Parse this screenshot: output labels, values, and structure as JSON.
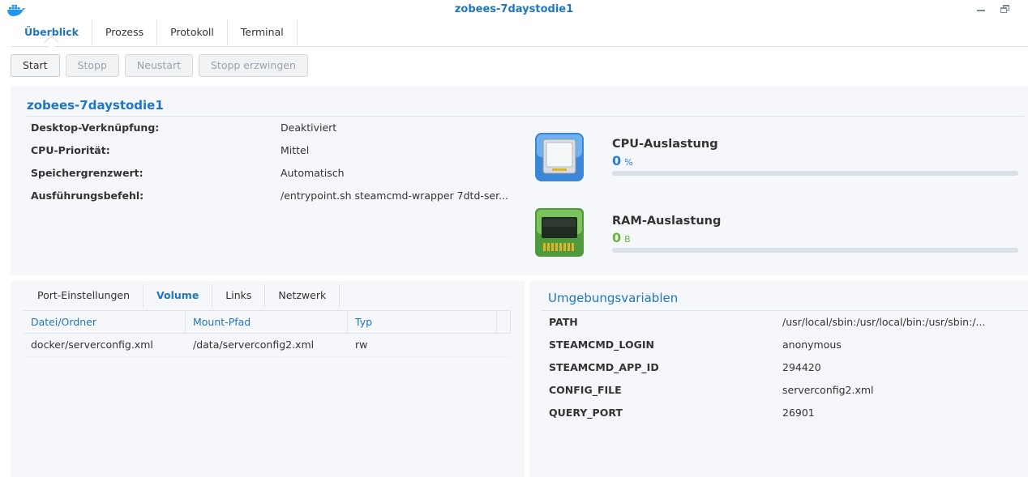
{
  "window": {
    "title": "zobees-7daystodie1"
  },
  "tabs": [
    {
      "label": "Überblick",
      "active": true
    },
    {
      "label": "Prozess"
    },
    {
      "label": "Protokoll"
    },
    {
      "label": "Terminal"
    }
  ],
  "actions": {
    "start": "Start",
    "stop": "Stopp",
    "restart": "Neustart",
    "force_stop": "Stopp erzwingen"
  },
  "overview": {
    "name": "zobees-7daystodie1",
    "rows": [
      {
        "key": "Desktop-Verknüpfung:",
        "value": "Deaktiviert"
      },
      {
        "key": "CPU-Priorität:",
        "value": "Mittel"
      },
      {
        "key": "Speichergrenzwert:",
        "value": "Automatisch"
      },
      {
        "key": "Ausführungsbefehl:",
        "value": "/entrypoint.sh steamcmd-wrapper 7dtd-ser..."
      }
    ],
    "cpu": {
      "label": "CPU-Auslastung",
      "value": "0",
      "unit": "%",
      "level": 0,
      "color": "#2a7ed6"
    },
    "ram": {
      "label": "RAM-Auslastung",
      "value": "0",
      "unit": "B",
      "level": 0,
      "color": "#6db33f"
    }
  },
  "subtabs": [
    {
      "label": "Port-Einstellungen"
    },
    {
      "label": "Volume",
      "active": true
    },
    {
      "label": "Links"
    },
    {
      "label": "Netzwerk"
    }
  ],
  "volume": {
    "headers": [
      "Datei/Ordner",
      "Mount-Pfad",
      "Typ"
    ],
    "rows": [
      [
        "docker/serverconfig.xml",
        "/data/serverconfig2.xml",
        "rw"
      ]
    ]
  },
  "env": {
    "title": "Umgebungsvariablen",
    "rows": [
      {
        "key": "PATH",
        "value": "/usr/local/sbin:/usr/local/bin:/usr/sbin:/..."
      },
      {
        "key": "STEAMCMD_LOGIN",
        "value": "anonymous"
      },
      {
        "key": "STEAMCMD_APP_ID",
        "value": "294420"
      },
      {
        "key": "CONFIG_FILE",
        "value": "serverconfig2.xml"
      },
      {
        "key": "QUERY_PORT",
        "value": "26901"
      }
    ]
  },
  "colors": {
    "accent": "#1f76c2",
    "panel": "#f5f7fa"
  }
}
